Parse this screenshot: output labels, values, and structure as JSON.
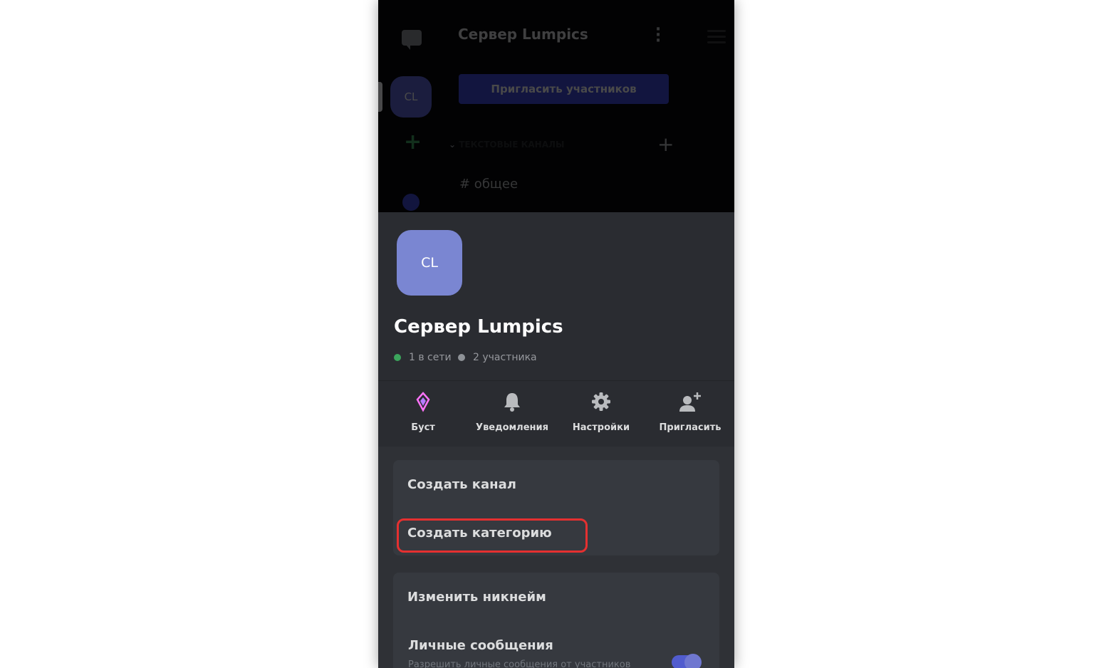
{
  "background_app": {
    "title": "Сервер Lumpics",
    "server_abbr": "CL",
    "invite_button": "Пригласить участников",
    "category": "ТЕКСТОВЫЕ КАНАЛЫ",
    "channel": "# общее"
  },
  "server": {
    "abbr": "CL",
    "name": "Сервер Lumpics",
    "online": "1 в сети",
    "members": "2 участника"
  },
  "actions": [
    {
      "label": "Буст",
      "icon": "boost-gem-icon"
    },
    {
      "label": "Уведомления",
      "icon": "bell-icon"
    },
    {
      "label": "Настройки",
      "icon": "gear-icon"
    },
    {
      "label": "Пригласить",
      "icon": "add-user-icon"
    }
  ],
  "menu": {
    "create_channel": "Создать канал",
    "create_category": "Создать категорию",
    "change_nickname": "Изменить никнейм",
    "direct_messages": "Личные сообщения",
    "direct_messages_desc": "Разрешить личные сообщения от участников"
  },
  "colors": {
    "accent": "#7a86d2",
    "online": "#3ba55c",
    "highlight": "#e53030",
    "boost": "#ff73fa"
  }
}
